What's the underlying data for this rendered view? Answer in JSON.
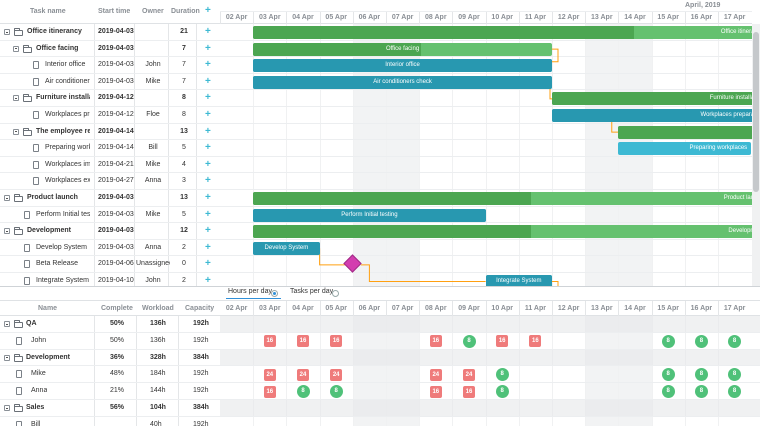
{
  "colors": {
    "accent": "#3db9d3",
    "task_green": "#65c16f",
    "task_blue": "#3db9d3",
    "milestone": "#d33daf",
    "link": "#ffa011",
    "overload": "#ef7b7b",
    "ok": "#4fc179"
  },
  "grid": {
    "headers": {
      "task_name": "Task name",
      "start_time": "Start time",
      "owner": "Owner",
      "duration": "Duration",
      "add_icon": "plus-icon"
    },
    "rows": [
      {
        "name": "Office itinerancy",
        "start": "2019-04-03",
        "owner": "",
        "duration": "21",
        "level": 0,
        "type": "project",
        "bold": true
      },
      {
        "name": "Office facing",
        "start": "2019-04-03",
        "owner": "",
        "duration": "7",
        "level": 1,
        "type": "project",
        "bold": true
      },
      {
        "name": "Interior office",
        "start": "2019-04-03",
        "owner": "John",
        "duration": "7",
        "level": 2,
        "type": "task",
        "bold": false
      },
      {
        "name": "Air conditioners chec",
        "start": "2019-04-03",
        "owner": "Mike",
        "duration": "7",
        "level": 2,
        "type": "task",
        "bold": false
      },
      {
        "name": "Furniture installation",
        "start": "2019-04-12",
        "owner": "",
        "duration": "8",
        "level": 1,
        "type": "project",
        "bold": true
      },
      {
        "name": "Workplaces preparat",
        "start": "2019-04-12",
        "owner": "Floe",
        "duration": "8",
        "level": 2,
        "type": "task",
        "bold": false
      },
      {
        "name": "The employee relocat",
        "start": "2019-04-14",
        "owner": "",
        "duration": "13",
        "level": 1,
        "type": "project",
        "bold": true
      },
      {
        "name": "Preparing workplace",
        "start": "2019-04-14",
        "owner": "Bill",
        "duration": "5",
        "level": 2,
        "type": "task",
        "bold": false
      },
      {
        "name": "Workplaces importat",
        "start": "2019-04-21",
        "owner": "Mike",
        "duration": "4",
        "level": 2,
        "type": "task",
        "bold": false
      },
      {
        "name": "Workplaces exportat",
        "start": "2019-04-27",
        "owner": "Anna",
        "duration": "3",
        "level": 2,
        "type": "task",
        "bold": false
      },
      {
        "name": "Product launch",
        "start": "2019-04-03",
        "owner": "",
        "duration": "13",
        "level": 0,
        "type": "project",
        "bold": true
      },
      {
        "name": "Perform Initial testing",
        "start": "2019-04-03",
        "owner": "Mike",
        "duration": "5",
        "level": 1,
        "type": "task",
        "bold": false
      },
      {
        "name": "Development",
        "start": "2019-04-03",
        "owner": "",
        "duration": "12",
        "level": 0,
        "type": "project",
        "bold": true
      },
      {
        "name": "Develop System",
        "start": "2019-04-03",
        "owner": "Anna",
        "duration": "2",
        "level": 1,
        "type": "task",
        "bold": false
      },
      {
        "name": "Beta Release",
        "start": "2019-04-06",
        "owner": "Unassigned",
        "duration": "0",
        "level": 1,
        "type": "task",
        "bold": false
      },
      {
        "name": "Integrate System",
        "start": "2019-04-10",
        "owner": "John",
        "duration": "2",
        "level": 1,
        "type": "task",
        "bold": false
      }
    ]
  },
  "timeline": {
    "month": "April, 2019",
    "days": [
      "02 Apr",
      "03 Apr",
      "04 Apr",
      "05 Apr",
      "06 Apr",
      "07 Apr",
      "08 Apr",
      "09 Apr",
      "10 Apr",
      "11 Apr",
      "12 Apr",
      "13 Apr",
      "14 Apr",
      "15 Apr",
      "16 Apr",
      "17 Apr"
    ],
    "weekend_indexes": [
      4,
      5,
      11,
      12
    ]
  },
  "bars": [
    {
      "row": 0,
      "label": "Office itinerancy",
      "start": 1,
      "days": 15.5,
      "progress": 0.74,
      "color": "green"
    },
    {
      "row": 1,
      "label": "Office facing",
      "start": 1,
      "days": 9,
      "progress": 0.56,
      "color": "green"
    },
    {
      "row": 2,
      "label": "Interior office",
      "start": 1,
      "days": 9,
      "progress": 1,
      "color": "blue"
    },
    {
      "row": 3,
      "label": "Air conditioners check",
      "start": 1,
      "days": 9,
      "progress": 1,
      "color": "blue"
    },
    {
      "row": 4,
      "label": "Furniture installation",
      "start": 10,
      "days": 6.5,
      "progress": 1,
      "color": "green"
    },
    {
      "row": 5,
      "label": "Workplaces preparation",
      "start": 10,
      "days": 6.5,
      "progress": 1,
      "color": "blue"
    },
    {
      "row": 6,
      "label": "",
      "start": 12,
      "days": 4.5,
      "progress": 1,
      "color": "green"
    },
    {
      "row": 7,
      "label": "Preparing workplaces",
      "start": 12,
      "days": 4,
      "progress": 0,
      "color": "blue"
    },
    {
      "row": 10,
      "label": "Product launch",
      "start": 1,
      "days": 15.5,
      "progress": 0.54,
      "color": "green"
    },
    {
      "row": 11,
      "label": "Perform Initial testing",
      "start": 1,
      "days": 7,
      "progress": 1,
      "color": "blue"
    },
    {
      "row": 12,
      "label": "Development",
      "start": 1,
      "days": 15.5,
      "progress": 0.54,
      "color": "green"
    },
    {
      "row": 13,
      "label": "Develop System",
      "start": 1,
      "days": 2,
      "progress": 1,
      "color": "blue"
    },
    {
      "row": 15,
      "label": "Integrate System",
      "start": 8,
      "days": 2,
      "progress": 1,
      "color": "blue"
    }
  ],
  "milestone": {
    "row": 14,
    "day": 4
  },
  "resource_toggle": {
    "hours": "Hours per day",
    "tasks": "Tasks per day",
    "selected": "hours"
  },
  "resources": {
    "headers": {
      "name": "Name",
      "complete": "Complete",
      "workload": "Workload",
      "capacity": "Capacity"
    },
    "rows": [
      {
        "name": "QA",
        "complete": "50%",
        "workload": "136h",
        "capacity": "192h",
        "group": true,
        "cells": []
      },
      {
        "name": "John",
        "complete": "50%",
        "workload": "136h",
        "capacity": "192h",
        "group": false,
        "cells": [
          {
            "day": 1,
            "value": "16",
            "kind": "red"
          },
          {
            "day": 2,
            "value": "16",
            "kind": "red"
          },
          {
            "day": 3,
            "value": "16",
            "kind": "red"
          },
          {
            "day": 6,
            "value": "16",
            "kind": "red"
          },
          {
            "day": 7,
            "value": "8",
            "kind": "green"
          },
          {
            "day": 8,
            "value": "16",
            "kind": "red"
          },
          {
            "day": 9,
            "value": "16",
            "kind": "red"
          },
          {
            "day": 13,
            "value": "8",
            "kind": "green"
          },
          {
            "day": 14,
            "value": "8",
            "kind": "green"
          },
          {
            "day": 15,
            "value": "8",
            "kind": "green"
          }
        ]
      },
      {
        "name": "Development",
        "complete": "36%",
        "workload": "328h",
        "capacity": "384h",
        "group": true,
        "cells": []
      },
      {
        "name": "Mike",
        "complete": "48%",
        "workload": "184h",
        "capacity": "192h",
        "group": false,
        "cells": [
          {
            "day": 1,
            "value": "24",
            "kind": "red"
          },
          {
            "day": 2,
            "value": "24",
            "kind": "red"
          },
          {
            "day": 3,
            "value": "24",
            "kind": "red"
          },
          {
            "day": 6,
            "value": "24",
            "kind": "red"
          },
          {
            "day": 7,
            "value": "24",
            "kind": "red"
          },
          {
            "day": 8,
            "value": "8",
            "kind": "green"
          },
          {
            "day": 13,
            "value": "8",
            "kind": "green"
          },
          {
            "day": 14,
            "value": "8",
            "kind": "green"
          },
          {
            "day": 15,
            "value": "8",
            "kind": "green"
          }
        ]
      },
      {
        "name": "Anna",
        "complete": "21%",
        "workload": "144h",
        "capacity": "192h",
        "group": false,
        "cells": [
          {
            "day": 1,
            "value": "16",
            "kind": "red"
          },
          {
            "day": 2,
            "value": "8",
            "kind": "green"
          },
          {
            "day": 3,
            "value": "8",
            "kind": "green"
          },
          {
            "day": 6,
            "value": "16",
            "kind": "red"
          },
          {
            "day": 7,
            "value": "16",
            "kind": "red"
          },
          {
            "day": 8,
            "value": "8",
            "kind": "green"
          },
          {
            "day": 13,
            "value": "8",
            "kind": "green"
          },
          {
            "day": 14,
            "value": "8",
            "kind": "green"
          },
          {
            "day": 15,
            "value": "8",
            "kind": "green"
          }
        ]
      },
      {
        "name": "Sales",
        "complete": "56%",
        "workload": "104h",
        "capacity": "384h",
        "group": true,
        "cells": []
      },
      {
        "name": "Bill",
        "complete": "",
        "workload": "40h",
        "capacity": "192h",
        "group": false,
        "cells": []
      }
    ]
  }
}
